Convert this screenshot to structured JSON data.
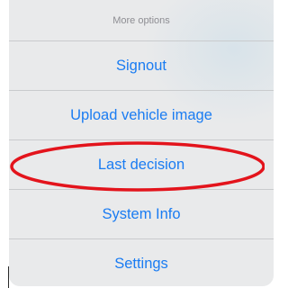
{
  "action_sheet": {
    "title": "More options",
    "items": [
      {
        "label": "Signout"
      },
      {
        "label": "Upload vehicle image"
      },
      {
        "label": "Last decision"
      },
      {
        "label": "System Info"
      },
      {
        "label": "Settings"
      }
    ],
    "highlighted_item": "Last decision"
  },
  "colors": {
    "sheet_background": "#e9eaeb",
    "action_text": "#1a7cf2",
    "title_text": "#8e8e93",
    "separator": "#c9cbcd",
    "annotation_ellipse": "#e3141c"
  }
}
